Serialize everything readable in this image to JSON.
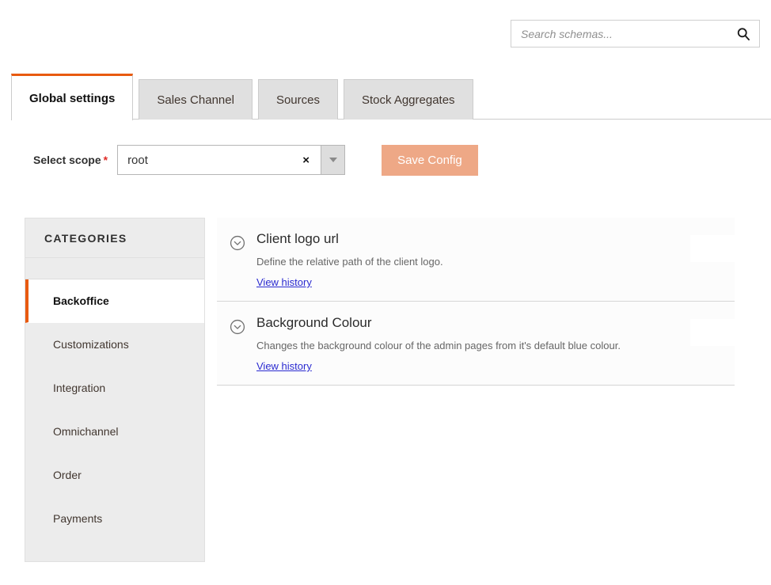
{
  "search": {
    "placeholder": "Search schemas...",
    "value": "",
    "icon": "search-icon"
  },
  "tabs": [
    {
      "label": "Global settings",
      "active": true
    },
    {
      "label": "Sales Channel",
      "active": false
    },
    {
      "label": "Sources",
      "active": false
    },
    {
      "label": "Stock Aggregates",
      "active": false
    }
  ],
  "scope": {
    "label": "Select scope",
    "required_mark": "*",
    "value": "root",
    "clear_label": "×",
    "arrow_icon": "chevron-down-icon"
  },
  "toolbar": {
    "save_label": "Save Config"
  },
  "sidebar": {
    "title": "CATEGORIES",
    "items": [
      {
        "label": "Backoffice",
        "active": true
      },
      {
        "label": "Customizations",
        "active": false
      },
      {
        "label": "Integration",
        "active": false
      },
      {
        "label": "Omnichannel",
        "active": false
      },
      {
        "label": "Order",
        "active": false
      },
      {
        "label": "Payments",
        "active": false
      }
    ]
  },
  "config_rows": [
    {
      "title": "Client logo url",
      "description": "Define the relative path of the client logo.",
      "history_link": "View history",
      "toggle_icon": "chevron-down-circle-icon",
      "field_value": ""
    },
    {
      "title": "Background Colour",
      "description": "Changes the background colour of the admin pages from it's default blue colour.",
      "history_link": "View history",
      "toggle_icon": "chevron-down-circle-icon",
      "field_value": ""
    }
  ],
  "colors": {
    "accent": "#e85a10",
    "link": "#2a2ad0",
    "save_disabled": "#eea886",
    "sidebar_bg": "#ececec",
    "tab_inactive": "#e0e0e0"
  }
}
